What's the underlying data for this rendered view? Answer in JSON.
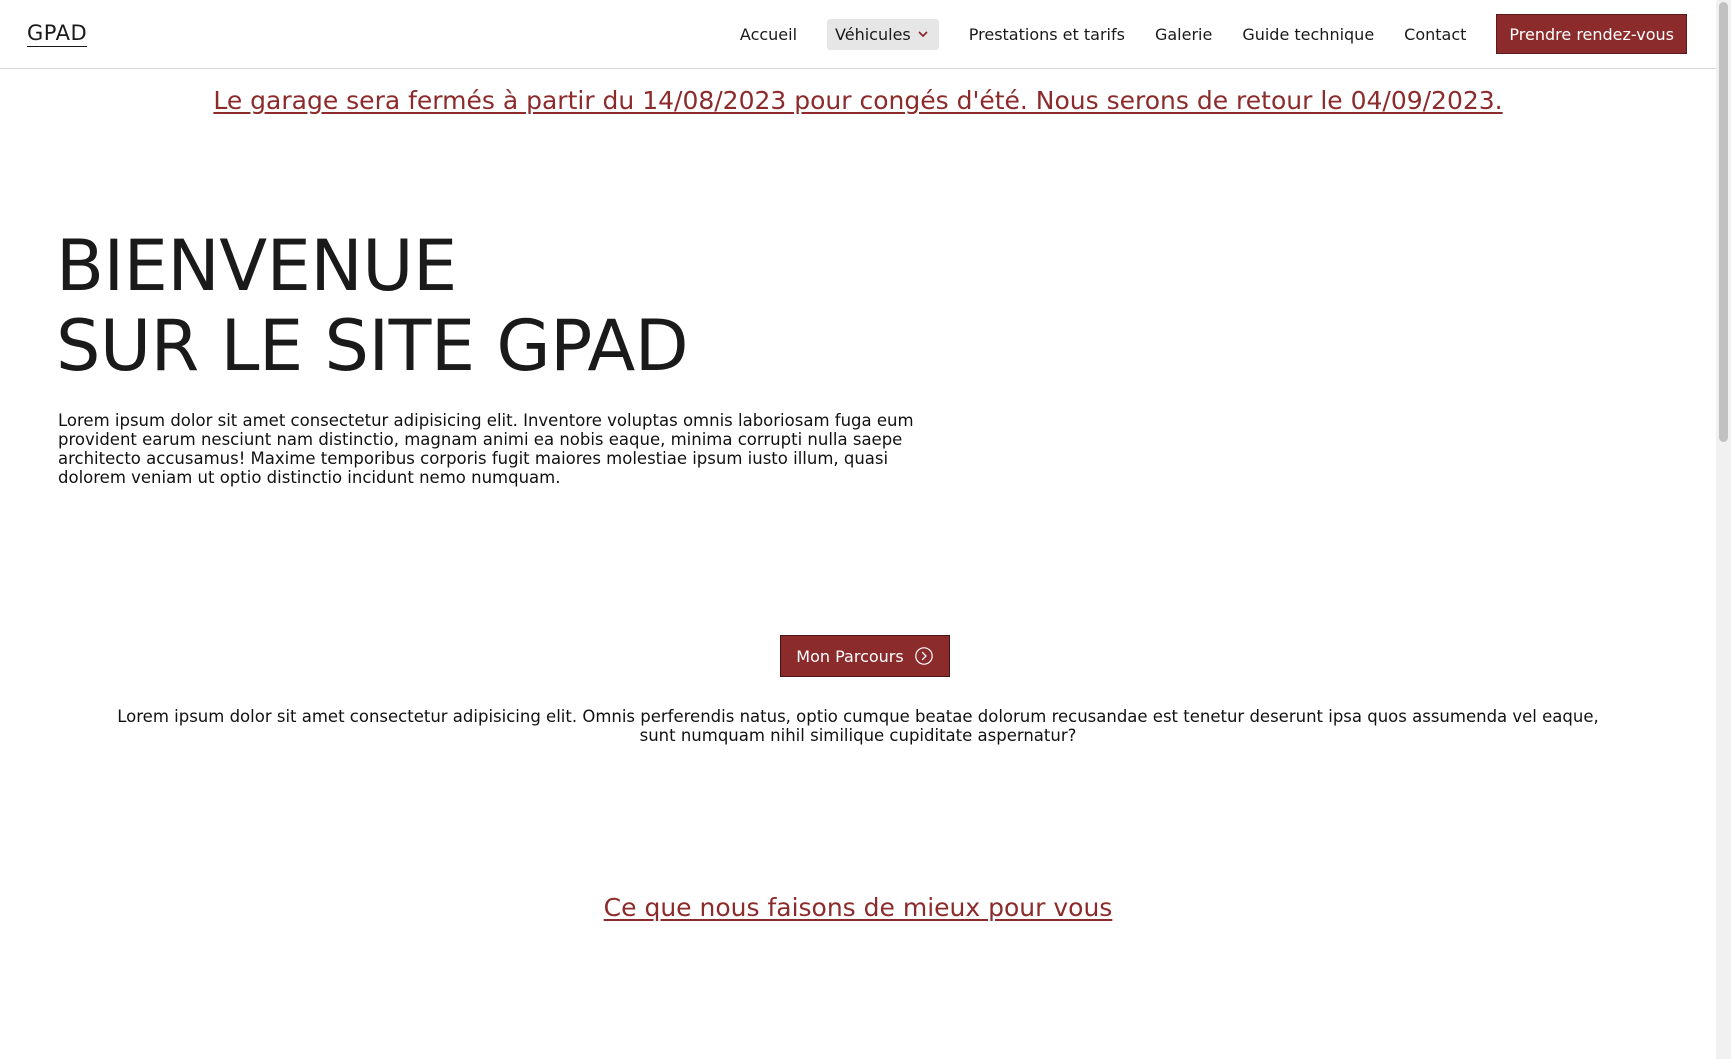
{
  "header": {
    "logo": "GPAD",
    "nav": {
      "accueil": "Accueil",
      "vehicules": "Véhicules",
      "prestations": "Prestations et tarifs",
      "galerie": "Galerie",
      "guide": "Guide technique",
      "contact": "Contact"
    },
    "cta": "Prendre rendez-vous"
  },
  "notice": "Le garage sera fermés à partir du 14/08/2023 pour congés d'été. Nous serons de retour le 04/09/2023.",
  "hero": {
    "title_line1": "BIENVENUE",
    "title_line2": "SUR LE SITE GPAD",
    "text": "Lorem ipsum dolor sit amet consectetur adipisicing elit. Inventore voluptas omnis laboriosam fuga eum provident earum nesciunt nam distinctio, magnam animi ea nobis eaque, minima corrupti nulla saepe architecto accusamus! Maxime temporibus corporis fugit maiores molestiae ipsum iusto illum, quasi dolorem veniam ut optio distinctio incidunt nemo numquam."
  },
  "parcours_button": "Mon Parcours",
  "intro_text": "Lorem ipsum dolor sit amet consectetur adipisicing elit. Omnis perferendis natus, optio cumque beatae dolorum recusandae est tenetur deserunt ipsa quos assumenda vel eaque, sunt numquam nihil similique cupiditate aspernatur?",
  "section_title": "Ce que nous faisons de mieux pour vous",
  "colors": {
    "accent": "#8c2b2b",
    "text": "#1a1a1a",
    "dropdown_bg": "#e6e6e6"
  },
  "icons": {
    "dropdown": "chevron-down-icon",
    "parcours": "circle-arrow-right-icon"
  }
}
